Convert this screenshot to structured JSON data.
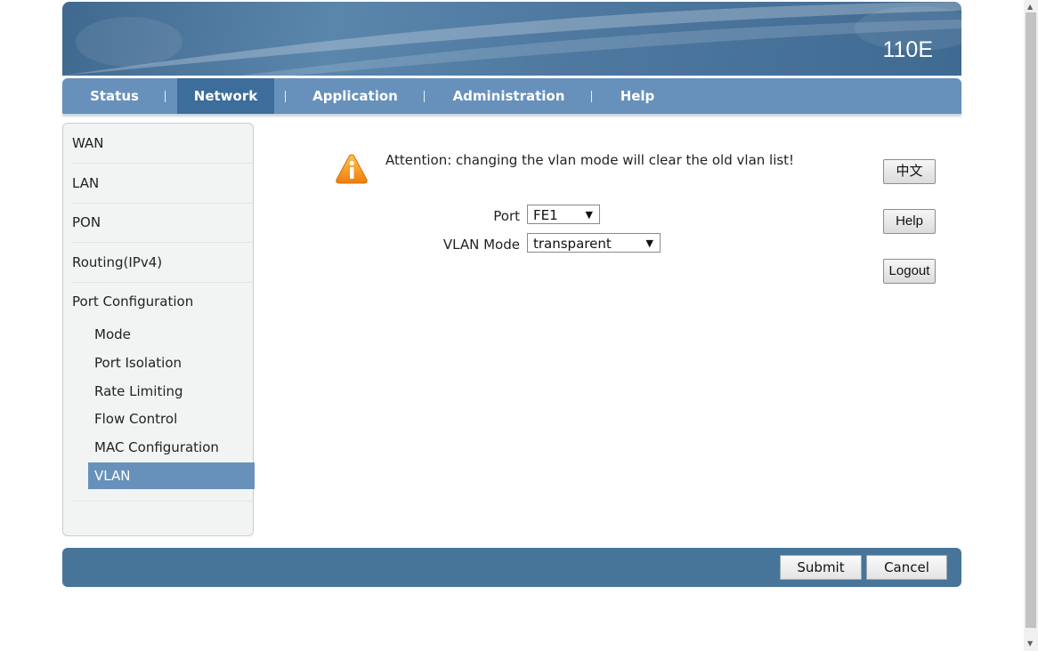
{
  "header": {
    "model": "110E"
  },
  "nav": {
    "items": [
      {
        "label": "Status"
      },
      {
        "label": "Network"
      },
      {
        "label": "Application"
      },
      {
        "label": "Administration"
      },
      {
        "label": "Help"
      }
    ],
    "active": "Network"
  },
  "sidebar": {
    "items": [
      "WAN",
      "LAN",
      "PON",
      "Routing(IPv4)",
      "Port Configuration"
    ],
    "subitems": [
      "Mode",
      "Port Isolation",
      "Rate Limiting",
      "Flow Control",
      "MAC Configuration",
      "VLAN"
    ],
    "active_sub": "VLAN"
  },
  "content": {
    "attention": "Attention: changing the vlan mode will clear the old vlan list!",
    "port_label": "Port",
    "port_value": "FE1",
    "vlan_mode_label": "VLAN Mode",
    "vlan_mode_value": "transparent"
  },
  "right_buttons": {
    "language": "中文",
    "help": "Help",
    "logout": "Logout"
  },
  "footer": {
    "submit": "Submit",
    "cancel": "Cancel"
  },
  "colors": {
    "nav_bg": "#6791bb",
    "nav_active": "#3d6d9b",
    "footer_bg": "#467599",
    "warning": "#f39c1f"
  }
}
